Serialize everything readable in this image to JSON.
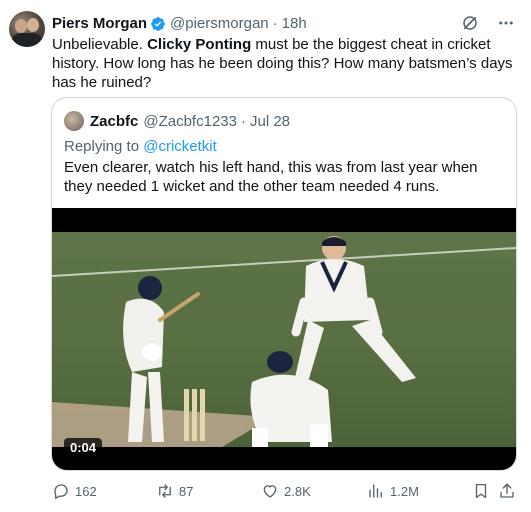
{
  "tweet": {
    "author_name": "Piers Morgan",
    "handle": "@piersmorgan",
    "separator": "·",
    "time": "18h",
    "text_before": "Unbelievable. ",
    "text_bold": "Clicky Ponting",
    "text_after": " must be the biggest cheat in cricket history. How long has he been doing this? How many batsmen’s days has he ruined?"
  },
  "quote": {
    "author_name": "Zacbfc",
    "handle": "@Zacbfc1233",
    "separator": "·",
    "date": "Jul 28",
    "replying_prefix": "Replying to ",
    "replying_mention": "@cricketkit",
    "text": "Even clearer, watch his left hand, this was from last year when they needed 1 wicket and the other team needed 4 runs.",
    "video_timestamp": "0:04"
  },
  "actions": {
    "replies": "162",
    "reposts": "87",
    "likes": "2.8K",
    "views": "1.2M"
  },
  "colors": {
    "verified": "#1d9bf0",
    "link": "#1d9bf0",
    "secondary_text": "#536471",
    "border": "#cfd9de"
  },
  "icons": [
    "verified-badge-icon",
    "grok-icon",
    "more-icon",
    "reply-icon",
    "repost-icon",
    "like-icon",
    "views-icon",
    "bookmark-icon",
    "share-icon"
  ]
}
